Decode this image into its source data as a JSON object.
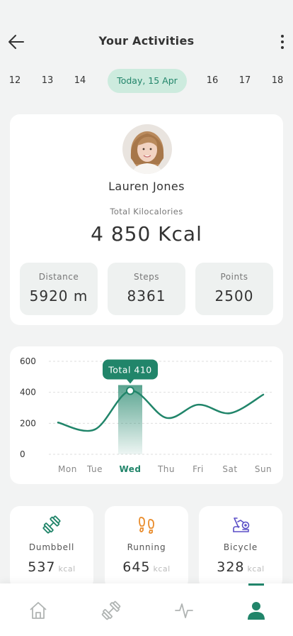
{
  "header": {
    "title": "Your Activities"
  },
  "dates": [
    {
      "label": "12",
      "active": false
    },
    {
      "label": "13",
      "active": false
    },
    {
      "label": "14",
      "active": false
    },
    {
      "label": "Today, 15 Apr",
      "active": true
    },
    {
      "label": "16",
      "active": false
    },
    {
      "label": "17",
      "active": false
    },
    {
      "label": "18",
      "active": false
    }
  ],
  "profile": {
    "name": "Lauren Jones",
    "kcal_label": "Total Kilocalories",
    "kcal_value": "4 850 Kcal",
    "stats": [
      {
        "label": "Distance",
        "value": "5920 m"
      },
      {
        "label": "Steps",
        "value": "8361"
      },
      {
        "label": "Points",
        "value": "2500"
      }
    ]
  },
  "chart_data": {
    "type": "line",
    "categories": [
      "Mon",
      "Tue",
      "Wed",
      "Thu",
      "Fri",
      "Sat",
      "Sun"
    ],
    "values": [
      205,
      160,
      410,
      235,
      320,
      265,
      385
    ],
    "y_ticks": [
      0,
      200,
      400,
      600
    ],
    "ylim": [
      0,
      600
    ],
    "highlight_index": 2,
    "tooltip": "Total 410",
    "grid": true,
    "accent_color": "#21856a"
  },
  "activities": [
    {
      "label": "Dumbbell",
      "value": "537",
      "unit": "kcal",
      "icon": "dumbbell-icon",
      "color": "#21856a"
    },
    {
      "label": "Running",
      "value": "645",
      "unit": "kcal",
      "icon": "footprints-icon",
      "color": "#e98b2a"
    },
    {
      "label": "Bicycle",
      "value": "328",
      "unit": "kcal",
      "icon": "bicycle-icon",
      "color": "#5b4fc7"
    }
  ],
  "nav": [
    {
      "name": "home",
      "icon": "home-icon",
      "active": false
    },
    {
      "name": "workouts",
      "icon": "dumbbell-icon",
      "active": false
    },
    {
      "name": "activity",
      "icon": "pulse-icon",
      "active": false
    },
    {
      "name": "profile",
      "icon": "user-icon",
      "active": true
    }
  ],
  "colors": {
    "accent": "#21856a",
    "accent_light": "#cdebde",
    "background": "#f2f3f3"
  }
}
